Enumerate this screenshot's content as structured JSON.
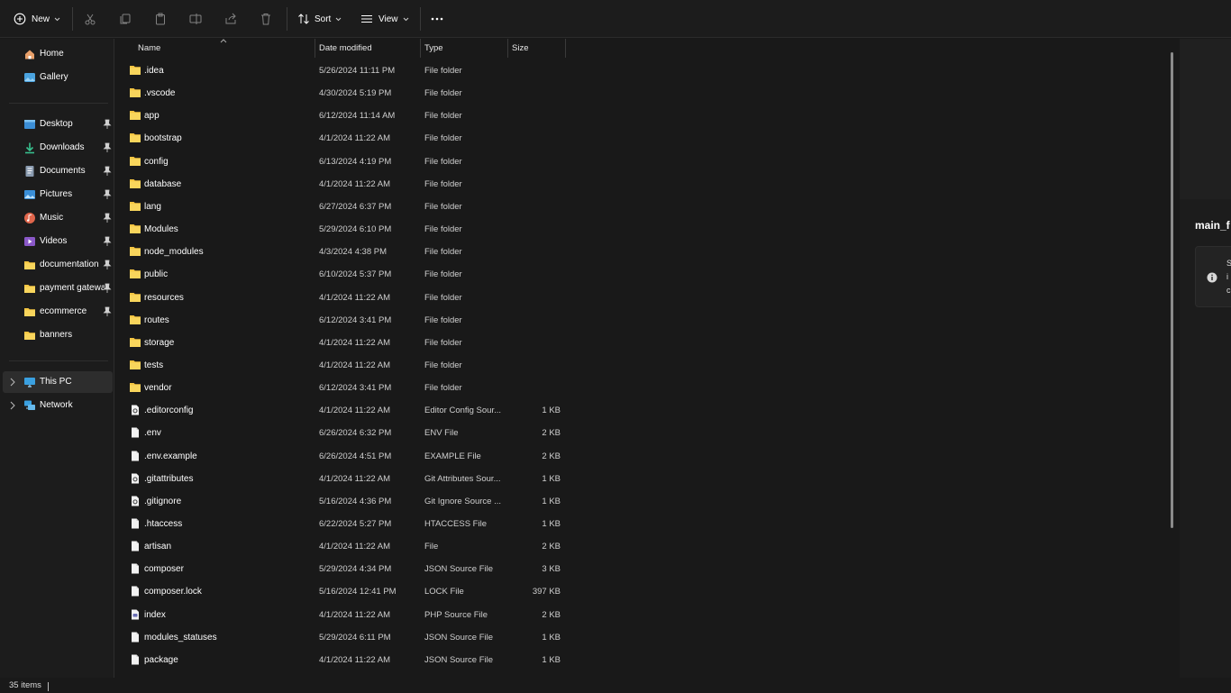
{
  "toolbar": {
    "new_label": "New",
    "sort_label": "Sort",
    "view_label": "View"
  },
  "sidebar": {
    "quick": [
      {
        "label": "Home",
        "icon": "home-icon"
      },
      {
        "label": "Gallery",
        "icon": "gallery-icon"
      }
    ],
    "pinned": [
      {
        "label": "Desktop",
        "icon": "desktop-icon",
        "pinned": true
      },
      {
        "label": "Downloads",
        "icon": "download-icon",
        "pinned": true
      },
      {
        "label": "Documents",
        "icon": "documents-icon",
        "pinned": true
      },
      {
        "label": "Pictures",
        "icon": "pictures-icon",
        "pinned": true
      },
      {
        "label": "Music",
        "icon": "music-icon",
        "pinned": true
      },
      {
        "label": "Videos",
        "icon": "videos-icon",
        "pinned": true
      },
      {
        "label": "documentation",
        "icon": "folder-icon",
        "pinned": true
      },
      {
        "label": "payment gatewa",
        "icon": "folder-icon",
        "pinned": true
      },
      {
        "label": "ecommerce",
        "icon": "folder-icon",
        "pinned": true
      },
      {
        "label": "banners",
        "icon": "folder-icon",
        "pinned": false
      }
    ],
    "locations": [
      {
        "label": "This PC",
        "icon": "pc-icon",
        "selected": true
      },
      {
        "label": "Network",
        "icon": "network-icon",
        "selected": false
      }
    ]
  },
  "columns": {
    "name": "Name",
    "date": "Date modified",
    "type": "Type",
    "size": "Size"
  },
  "files": [
    {
      "name": ".idea",
      "date": "5/26/2024 11:11 PM",
      "type": "File folder",
      "size": "",
      "kind": "folder"
    },
    {
      "name": ".vscode",
      "date": "4/30/2024 5:19 PM",
      "type": "File folder",
      "size": "",
      "kind": "folder"
    },
    {
      "name": "app",
      "date": "6/12/2024 11:14 AM",
      "type": "File folder",
      "size": "",
      "kind": "folder"
    },
    {
      "name": "bootstrap",
      "date": "4/1/2024 11:22 AM",
      "type": "File folder",
      "size": "",
      "kind": "folder"
    },
    {
      "name": "config",
      "date": "6/13/2024 4:19 PM",
      "type": "File folder",
      "size": "",
      "kind": "folder"
    },
    {
      "name": "database",
      "date": "4/1/2024 11:22 AM",
      "type": "File folder",
      "size": "",
      "kind": "folder"
    },
    {
      "name": "lang",
      "date": "6/27/2024 6:37 PM",
      "type": "File folder",
      "size": "",
      "kind": "folder"
    },
    {
      "name": "Modules",
      "date": "5/29/2024 6:10 PM",
      "type": "File folder",
      "size": "",
      "kind": "folder"
    },
    {
      "name": "node_modules",
      "date": "4/3/2024 4:38 PM",
      "type": "File folder",
      "size": "",
      "kind": "folder"
    },
    {
      "name": "public",
      "date": "6/10/2024 5:37 PM",
      "type": "File folder",
      "size": "",
      "kind": "folder"
    },
    {
      "name": "resources",
      "date": "4/1/2024 11:22 AM",
      "type": "File folder",
      "size": "",
      "kind": "folder"
    },
    {
      "name": "routes",
      "date": "6/12/2024 3:41 PM",
      "type": "File folder",
      "size": "",
      "kind": "folder"
    },
    {
      "name": "storage",
      "date": "4/1/2024 11:22 AM",
      "type": "File folder",
      "size": "",
      "kind": "folder"
    },
    {
      "name": "tests",
      "date": "4/1/2024 11:22 AM",
      "type": "File folder",
      "size": "",
      "kind": "folder"
    },
    {
      "name": "vendor",
      "date": "6/12/2024 3:41 PM",
      "type": "File folder",
      "size": "",
      "kind": "folder"
    },
    {
      "name": ".editorconfig",
      "date": "4/1/2024 11:22 AM",
      "type": "Editor Config Sour...",
      "size": "1 KB",
      "kind": "gear-file"
    },
    {
      "name": ".env",
      "date": "6/26/2024 6:32 PM",
      "type": "ENV File",
      "size": "2 KB",
      "kind": "file"
    },
    {
      "name": ".env.example",
      "date": "6/26/2024 4:51 PM",
      "type": "EXAMPLE File",
      "size": "2 KB",
      "kind": "file"
    },
    {
      "name": ".gitattributes",
      "date": "4/1/2024 11:22 AM",
      "type": "Git Attributes Sour...",
      "size": "1 KB",
      "kind": "gear-file"
    },
    {
      "name": ".gitignore",
      "date": "5/16/2024 4:36 PM",
      "type": "Git Ignore Source ...",
      "size": "1 KB",
      "kind": "gear-file"
    },
    {
      "name": ".htaccess",
      "date": "6/22/2024 5:27 PM",
      "type": "HTACCESS File",
      "size": "1 KB",
      "kind": "file"
    },
    {
      "name": "artisan",
      "date": "4/1/2024 11:22 AM",
      "type": "File",
      "size": "2 KB",
      "kind": "file"
    },
    {
      "name": "composer",
      "date": "5/29/2024 4:34 PM",
      "type": "JSON Source File",
      "size": "3 KB",
      "kind": "file"
    },
    {
      "name": "composer.lock",
      "date": "5/16/2024 12:41 PM",
      "type": "LOCK File",
      "size": "397 KB",
      "kind": "file"
    },
    {
      "name": "index",
      "date": "4/1/2024 11:22 AM",
      "type": "PHP Source File",
      "size": "2 KB",
      "kind": "php-file"
    },
    {
      "name": "modules_statuses",
      "date": "5/29/2024 6:11 PM",
      "type": "JSON Source File",
      "size": "1 KB",
      "kind": "file"
    },
    {
      "name": "package",
      "date": "4/1/2024 11:22 AM",
      "type": "JSON Source File",
      "size": "1 KB",
      "kind": "file"
    }
  ],
  "details": {
    "title": "main_f",
    "lines": [
      "S",
      "i",
      "c"
    ]
  },
  "status": {
    "item_count": "35 items"
  },
  "colors": {
    "background": "#191919",
    "folder": "#f4c542",
    "text": "#ffffff"
  }
}
